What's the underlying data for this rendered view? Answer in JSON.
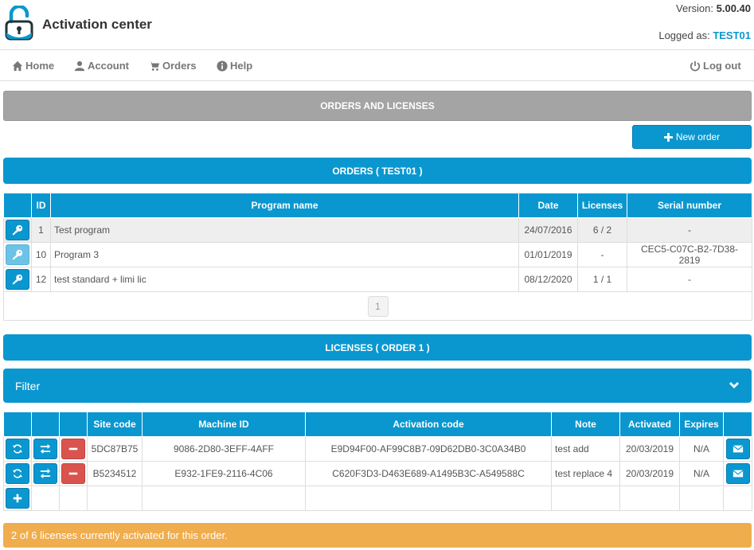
{
  "header": {
    "title": "Activation center",
    "version_label": "Version:",
    "version": "5.00.40",
    "logged_label": "Logged as:",
    "user": "TEST01"
  },
  "nav": {
    "home": "Home",
    "account": "Account",
    "orders": "Orders",
    "help": "Help",
    "logout": "Log out"
  },
  "section_title": "ORDERS AND LICENSES",
  "new_order_label": "New order",
  "orders": {
    "title": "ORDERS ( TEST01 )",
    "columns": [
      "ID",
      "Program name",
      "Date",
      "Licenses",
      "Serial number"
    ],
    "rows": [
      {
        "id": "1",
        "program": "Test program",
        "date": "24/07/2016",
        "licenses": "6 / 2",
        "serial": "-"
      },
      {
        "id": "10",
        "program": "Program 3",
        "date": "01/01/2019",
        "licenses": "-",
        "serial": "CEC5-C07C-B2-7D38-2819"
      },
      {
        "id": "12",
        "program": "test standard + limi lic",
        "date": "08/12/2020",
        "licenses": "1 / 1",
        "serial": "-"
      }
    ],
    "page": "1"
  },
  "licenses": {
    "title": "LICENSES ( ORDER 1 )",
    "filter_label": "Filter",
    "columns": [
      "Site code",
      "Machine ID",
      "Activation code",
      "Note",
      "Activated",
      "Expires"
    ],
    "rows": [
      {
        "site": "5DC87B75",
        "machine": "9086-2D80-3EFF-4AFF",
        "activation": "E9D94F00-AF99C8B7-09D62DB0-3C0A34B0",
        "note": "test add",
        "activated": "20/03/2019",
        "expires": "N/A"
      },
      {
        "site": "B5234512",
        "machine": "E932-1FE9-2116-4C06",
        "activation": "C620F3D3-D463E689-A1495B3C-A549588C",
        "note": "test replace 4",
        "activated": "20/03/2019",
        "expires": "N/A"
      }
    ]
  },
  "status_message": "2 of 6 licenses currently activated for this order.",
  "colors": {
    "primary": "#0a97cf",
    "danger": "#d9534f",
    "warning": "#f0ad4e",
    "gray": "#a4a4a4"
  },
  "icons": [
    "lock-icon",
    "home-icon",
    "user-icon",
    "cart-icon",
    "info-icon",
    "power-icon",
    "plus-icon",
    "key-icon",
    "refresh-icon",
    "swap-icon",
    "minus-icon",
    "envelope-icon",
    "chevron-down-icon"
  ]
}
